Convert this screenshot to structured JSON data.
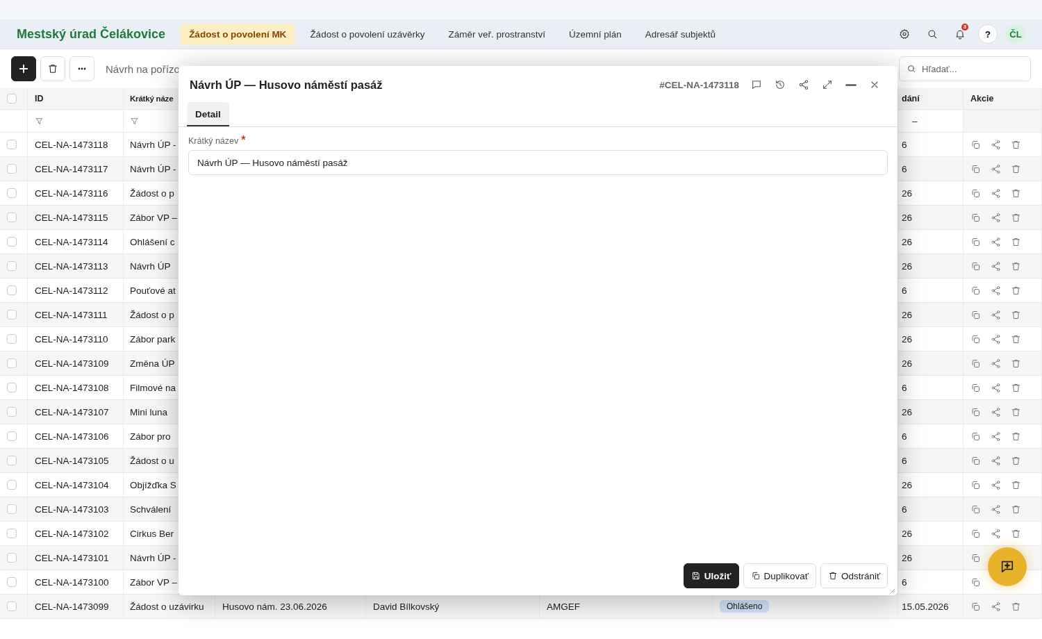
{
  "brand": "Mestský úrad Čelákovice",
  "nav_tabs": [
    {
      "label": "Žádost o povolení MK",
      "selected": true
    },
    {
      "label": "Žádost o povolení uzávěrky",
      "selected": false
    },
    {
      "label": "Záměr veř. prostranství",
      "selected": false
    },
    {
      "label": "Územní plán",
      "selected": false
    },
    {
      "label": "Adresář subjektů",
      "selected": false
    }
  ],
  "header": {
    "notification_count": "3",
    "help": "?",
    "avatar": "ČL"
  },
  "toolbar": {
    "breadcrumb": "Návrh na pořízo",
    "search": {
      "placeholder": "Hľadať..."
    }
  },
  "table": {
    "header": {
      "checked": false,
      "id": "ID",
      "short_name": "Krátký náze",
      "date": "dání",
      "actions": "Akcie"
    },
    "filter_row": {
      "date": "–"
    },
    "rows": [
      {
        "id": "CEL-NA-1473118",
        "short_name": "Návrh ÚP -",
        "date": "6",
        "checked": false
      },
      {
        "id": "CEL-NA-1473117",
        "short_name": "Návrh ÚP -",
        "date": "6",
        "checked": false
      },
      {
        "id": "CEL-NA-1473116",
        "short_name": "Žádost o p",
        "date": "26",
        "checked": false
      },
      {
        "id": "CEL-NA-1473115",
        "short_name": "Zábor VP –",
        "date": "26",
        "checked": false
      },
      {
        "id": "CEL-NA-1473114",
        "short_name": "Ohlášení c",
        "date": "26",
        "checked": false
      },
      {
        "id": "CEL-NA-1473113",
        "short_name": "Návrh ÚP",
        "date": "26",
        "checked": false
      },
      {
        "id": "CEL-NA-1473112",
        "short_name": "Pouťové at",
        "date": "6",
        "checked": false
      },
      {
        "id": "CEL-NA-1473111",
        "short_name": "Žádost o p",
        "date": "26",
        "checked": false
      },
      {
        "id": "CEL-NA-1473110",
        "short_name": "Zábor park",
        "date": "26",
        "checked": false
      },
      {
        "id": "CEL-NA-1473109",
        "short_name": "Změna ÚP",
        "date": "26",
        "checked": false
      },
      {
        "id": "CEL-NA-1473108",
        "short_name": "Filmové na",
        "date": "6",
        "checked": false
      },
      {
        "id": "CEL-NA-1473107",
        "short_name": "Mini luna",
        "date": "26",
        "checked": false
      },
      {
        "id": "CEL-NA-1473106",
        "short_name": "Zábor pro",
        "date": "6",
        "checked": false
      },
      {
        "id": "CEL-NA-1473105",
        "short_name": "Žádost o u",
        "date": "6",
        "checked": false
      },
      {
        "id": "CEL-NA-1473104",
        "short_name": "Objížďka S",
        "date": "26",
        "checked": false
      },
      {
        "id": "CEL-NA-1473103",
        "short_name": "Schválení",
        "date": "6",
        "checked": false
      },
      {
        "id": "CEL-NA-1473102",
        "short_name": "Cirkus Ber",
        "date": "26",
        "checked": false
      },
      {
        "id": "CEL-NA-1473101",
        "short_name": "Návrh ÚP -",
        "date": "26",
        "checked": false
      },
      {
        "id": "CEL-NA-1473100",
        "short_name": "Zábor VP –",
        "date": "6",
        "checked": false
      },
      {
        "id": "CEL-NA-1473099",
        "short_name": "Žádost o uzávirku",
        "address": "Husovo nám. 23.06.2026",
        "person": "David Bílkovský",
        "column_6": "AMGEF",
        "status": "Ohlášeno",
        "color": "#cfe0f7",
        "date": "15.05.2026",
        "checked": false
      }
    ]
  },
  "modal": {
    "title": "Návrh ÚP — Husovo náměstí pasáž",
    "record_id": "#CEL-NA-1473118",
    "tabs": [
      {
        "label": "Detail",
        "selected": true
      }
    ],
    "field": {
      "label": "Krátký název",
      "required_mark": "*",
      "value": "Návrh ÚP — Husovo náměstí pasáž"
    },
    "buttons": [
      {
        "label": "Uložiť",
        "kind": "primary"
      },
      {
        "label": "Duplikovať",
        "kind": "secondary"
      },
      {
        "label": "Odstrániť",
        "kind": "secondary"
      }
    ]
  }
}
